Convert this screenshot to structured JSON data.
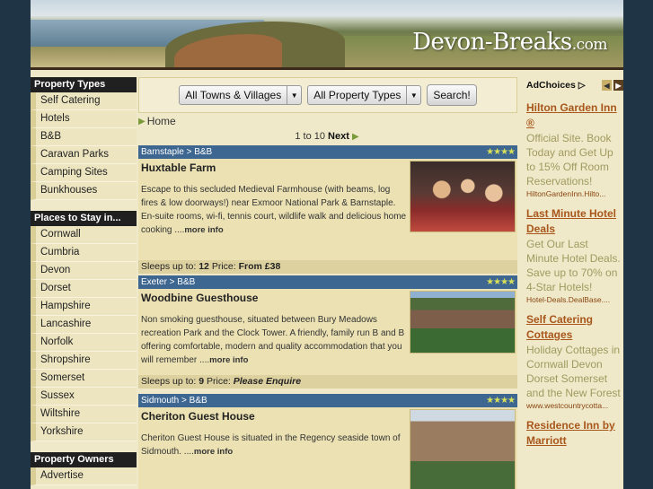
{
  "brand": {
    "name": "Devon-Breaks",
    "tld": ".com"
  },
  "sidebar": {
    "property_types_heading": "Property Types",
    "property_types": [
      "Self Catering",
      "Hotels",
      "B&B",
      "Caravan Parks",
      "Camping Sites",
      "Bunkhouses"
    ],
    "places_heading": "Places to Stay in...",
    "places": [
      "Cornwall",
      "Cumbria",
      "Devon",
      "Dorset",
      "Hampshire",
      "Lancashire",
      "Norfolk",
      "Shropshire",
      "Somerset",
      "Sussex",
      "Wiltshire",
      "Yorkshire"
    ],
    "owners_heading": "Property Owners",
    "owners": [
      "Advertise"
    ]
  },
  "search": {
    "towns_select": "All Towns & Villages",
    "property_select": "All Property Types",
    "search_button": "Search!"
  },
  "breadcrumb": {
    "home": "Home"
  },
  "pager": {
    "range": "1 to 10",
    "next": "Next"
  },
  "listings": [
    {
      "location": "Barnstaple > B&B",
      "stars": "★★★★",
      "title": "Huxtable Farm",
      "description": "Escape to this secluded Medieval Farmhouse (with beams, log fires & low doorways!) near Exmoor National Park & Barnstaple. En-suite rooms, wi-fi, tennis court, wildlife walk and delicious home cooking ....",
      "more": "more info",
      "sleeps_label": "Sleeps up to:",
      "sleeps": "12",
      "price_label": "Price:",
      "price": "From £38"
    },
    {
      "location": "Exeter > B&B",
      "stars": "★★★★",
      "title": "Woodbine Guesthouse",
      "description": "Non smoking guesthouse, situated between Bury Meadows recreation Park and the Clock Tower. A friendly, family run B and B offering comfortable, modern and quality accommodation that you will remember ....",
      "more": "more info",
      "sleeps_label": "Sleeps up to:",
      "sleeps": "9",
      "price_label": "Price:",
      "price": "Please Enquire"
    },
    {
      "location": "Sidmouth > B&B",
      "stars": "★★★★",
      "title": "Cheriton Guest House",
      "description": "Cheriton Guest House is situated in the Regency seaside town of Sidmouth. ....",
      "more": "more info"
    }
  ],
  "ads": {
    "adchoices": "AdChoices",
    "items": [
      {
        "title": "Hilton Garden Inn ®",
        "text": "Official Site. Book Today and Get Up to 15% Off Room Reservations!",
        "url": "HiltonGardenInn.Hilto..."
      },
      {
        "title": "Last Minute Hotel Deals",
        "text": "Get Our Last Minute Hotel Deals. Save up to 70% on 4-Star Hotels!",
        "url": "Hotel-Deals.DealBase...."
      },
      {
        "title": "Self Catering Cottages",
        "text": "Holiday Cottages in Cornwall Devon Dorset Somerset and the New Forest",
        "url": "www.westcountrycotta..."
      },
      {
        "title": "Residence Inn by Marriott",
        "text": "",
        "url": ""
      }
    ]
  }
}
